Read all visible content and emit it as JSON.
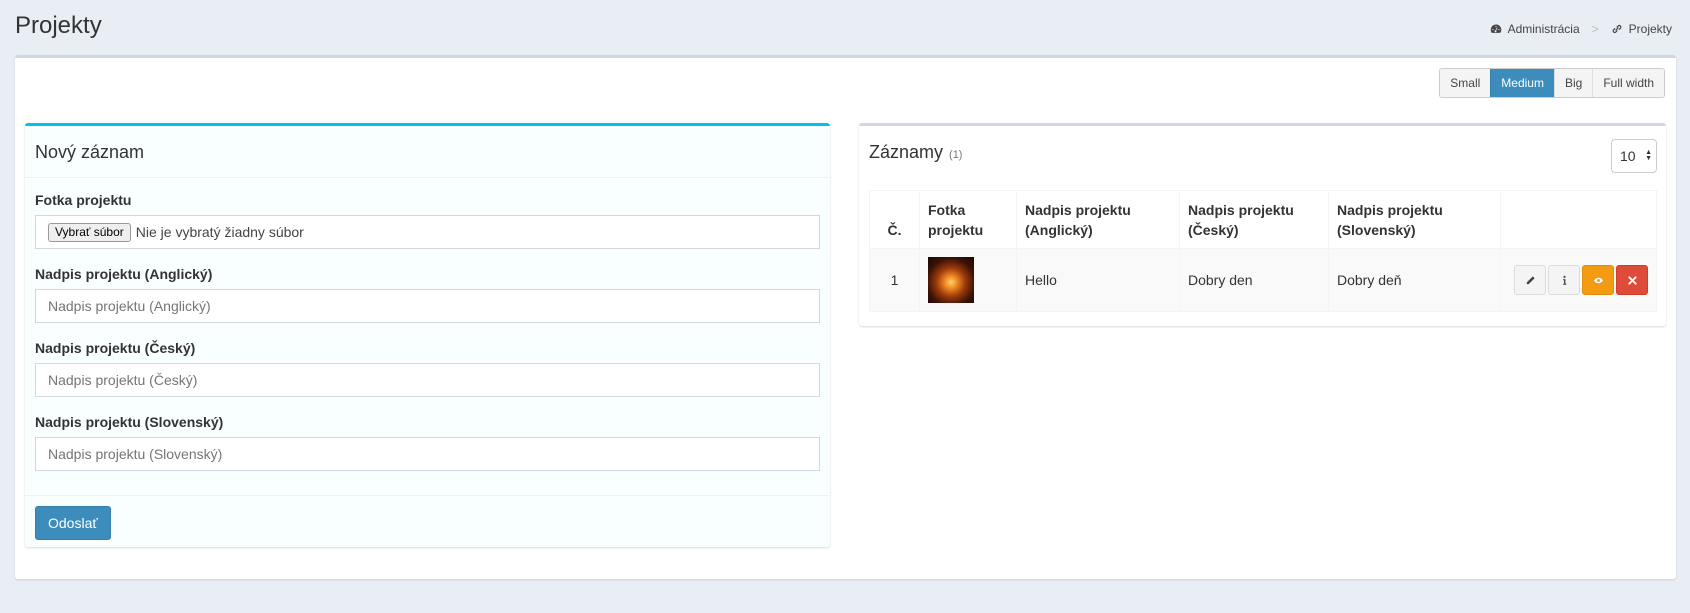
{
  "header": {
    "title": "Projekty",
    "breadcrumb": [
      {
        "label": "Administrácia",
        "icon": "dashboard-icon"
      },
      {
        "label": "Projekty",
        "icon": "link-icon"
      }
    ],
    "separator": ">"
  },
  "size_buttons": [
    {
      "label": "Small",
      "active": false
    },
    {
      "label": "Medium",
      "active": true
    },
    {
      "label": "Big",
      "active": false
    },
    {
      "label": "Full width",
      "active": false
    }
  ],
  "new_record": {
    "title": "Nový záznam",
    "photo": {
      "label": "Fotka projektu",
      "button": "Vybrať súbor",
      "status": "Nie je vybratý žiadny súbor"
    },
    "fields": [
      {
        "label": "Nadpis projektu (Anglický)",
        "placeholder": "Nadpis projektu (Anglický)",
        "value": ""
      },
      {
        "label": "Nadpis projektu (Český)",
        "placeholder": "Nadpis projektu (Český)",
        "value": ""
      },
      {
        "label": "Nadpis projektu (Slovenský)",
        "placeholder": "Nadpis projektu (Slovenský)",
        "value": ""
      }
    ],
    "submit": "Odoslať"
  },
  "records": {
    "title": "Záznamy",
    "count": "(1)",
    "per_page": "10",
    "columns": [
      "Č.",
      "Fotka projektu",
      "Nadpis projektu (Anglický)",
      "Nadpis projektu (Český)",
      "Nadpis projektu (Slovenský)",
      ""
    ],
    "rows": [
      {
        "num": "1",
        "photo": "sunset-photo",
        "en": "Hello",
        "cz": "Dobry den",
        "sk": "Dobry deň"
      }
    ],
    "actions": [
      "pencil-icon",
      "info-icon",
      "eye-icon",
      "close-icon"
    ]
  },
  "colors": {
    "primary": "#3c8dbc",
    "info_border": "#00c0ef",
    "warning": "#f39c12",
    "danger": "#dd4b39",
    "background": "#e9edf4"
  }
}
